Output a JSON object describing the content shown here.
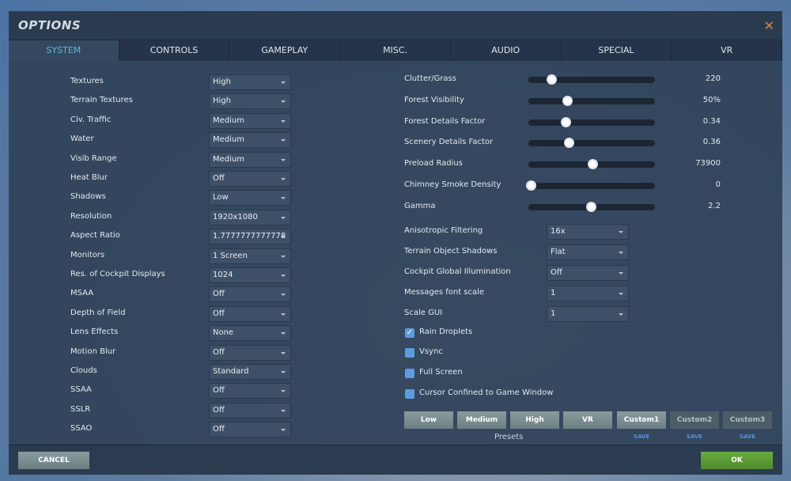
{
  "title": "OPTIONS",
  "tabs": [
    "SYSTEM",
    "CONTROLS",
    "GAMEPLAY",
    "MISC.",
    "AUDIO",
    "SPECIAL",
    "VR"
  ],
  "left_settings": [
    {
      "label": "Textures",
      "value": "High"
    },
    {
      "label": "Terrain Textures",
      "value": "High"
    },
    {
      "label": "Civ. Traffic",
      "value": "Medium"
    },
    {
      "label": "Water",
      "value": "Medium"
    },
    {
      "label": "Visib Range",
      "value": "Medium"
    },
    {
      "label": "Heat Blur",
      "value": "Off"
    },
    {
      "label": "Shadows",
      "value": "Low"
    },
    {
      "label": "Resolution",
      "value": "1920x1080"
    },
    {
      "label": "Aspect Ratio",
      "value": "1.7777777777778"
    },
    {
      "label": "Monitors",
      "value": "1 Screen"
    },
    {
      "label": "Res. of Cockpit Displays",
      "value": "1024"
    },
    {
      "label": "MSAA",
      "value": "Off"
    },
    {
      "label": "Depth of Field",
      "value": "Off"
    },
    {
      "label": "Lens Effects",
      "value": "None"
    },
    {
      "label": "Motion Blur",
      "value": "Off"
    },
    {
      "label": "Clouds",
      "value": "Standard"
    },
    {
      "label": "SSAA",
      "value": "Off"
    },
    {
      "label": "SSLR",
      "value": "Off"
    },
    {
      "label": "SSAO",
      "value": "Off"
    }
  ],
  "sliders": [
    {
      "label": "Clutter/Grass",
      "value": "220",
      "fraction": 0.16
    },
    {
      "label": "Forest Visibility",
      "value": "50%",
      "fraction": 0.29
    },
    {
      "label": "Forest Details Factor",
      "value": "0.34",
      "fraction": 0.275
    },
    {
      "label": "Scenery Details Factor",
      "value": "0.36",
      "fraction": 0.3
    },
    {
      "label": "Preload Radius",
      "value": "73900",
      "fraction": 0.49
    },
    {
      "label": "Chimney Smoke Density",
      "value": "0",
      "fraction": 0.0
    },
    {
      "label": "Gamma",
      "value": "2.2",
      "fraction": 0.475
    }
  ],
  "right_settings": [
    {
      "label": "Anisotropic Filtering",
      "value": "16x"
    },
    {
      "label": "Terrain Object Shadows",
      "value": "Flat"
    },
    {
      "label": "Cockpit Global Illumination",
      "value": "Off"
    },
    {
      "label": "Messages font scale",
      "value": "1"
    },
    {
      "label": "Scale GUI",
      "value": "1"
    }
  ],
  "checkboxes": [
    {
      "label": "Rain Droplets",
      "checked": true
    },
    {
      "label": "Vsync",
      "checked": false
    },
    {
      "label": "Full Screen",
      "checked": false
    },
    {
      "label": "Cursor Confined to Game Window",
      "checked": false
    }
  ],
  "presets": {
    "label": "Presets",
    "buttons": [
      "Low",
      "Medium",
      "High",
      "VR",
      "Custom1",
      "Custom2",
      "Custom3"
    ],
    "save_label": "SAVE"
  },
  "footer": {
    "cancel": "CANCEL",
    "ok": "OK"
  },
  "colors": {
    "accent": "#5fb7d6",
    "ok": "#5f9a3a",
    "close": "#d08a4e"
  }
}
